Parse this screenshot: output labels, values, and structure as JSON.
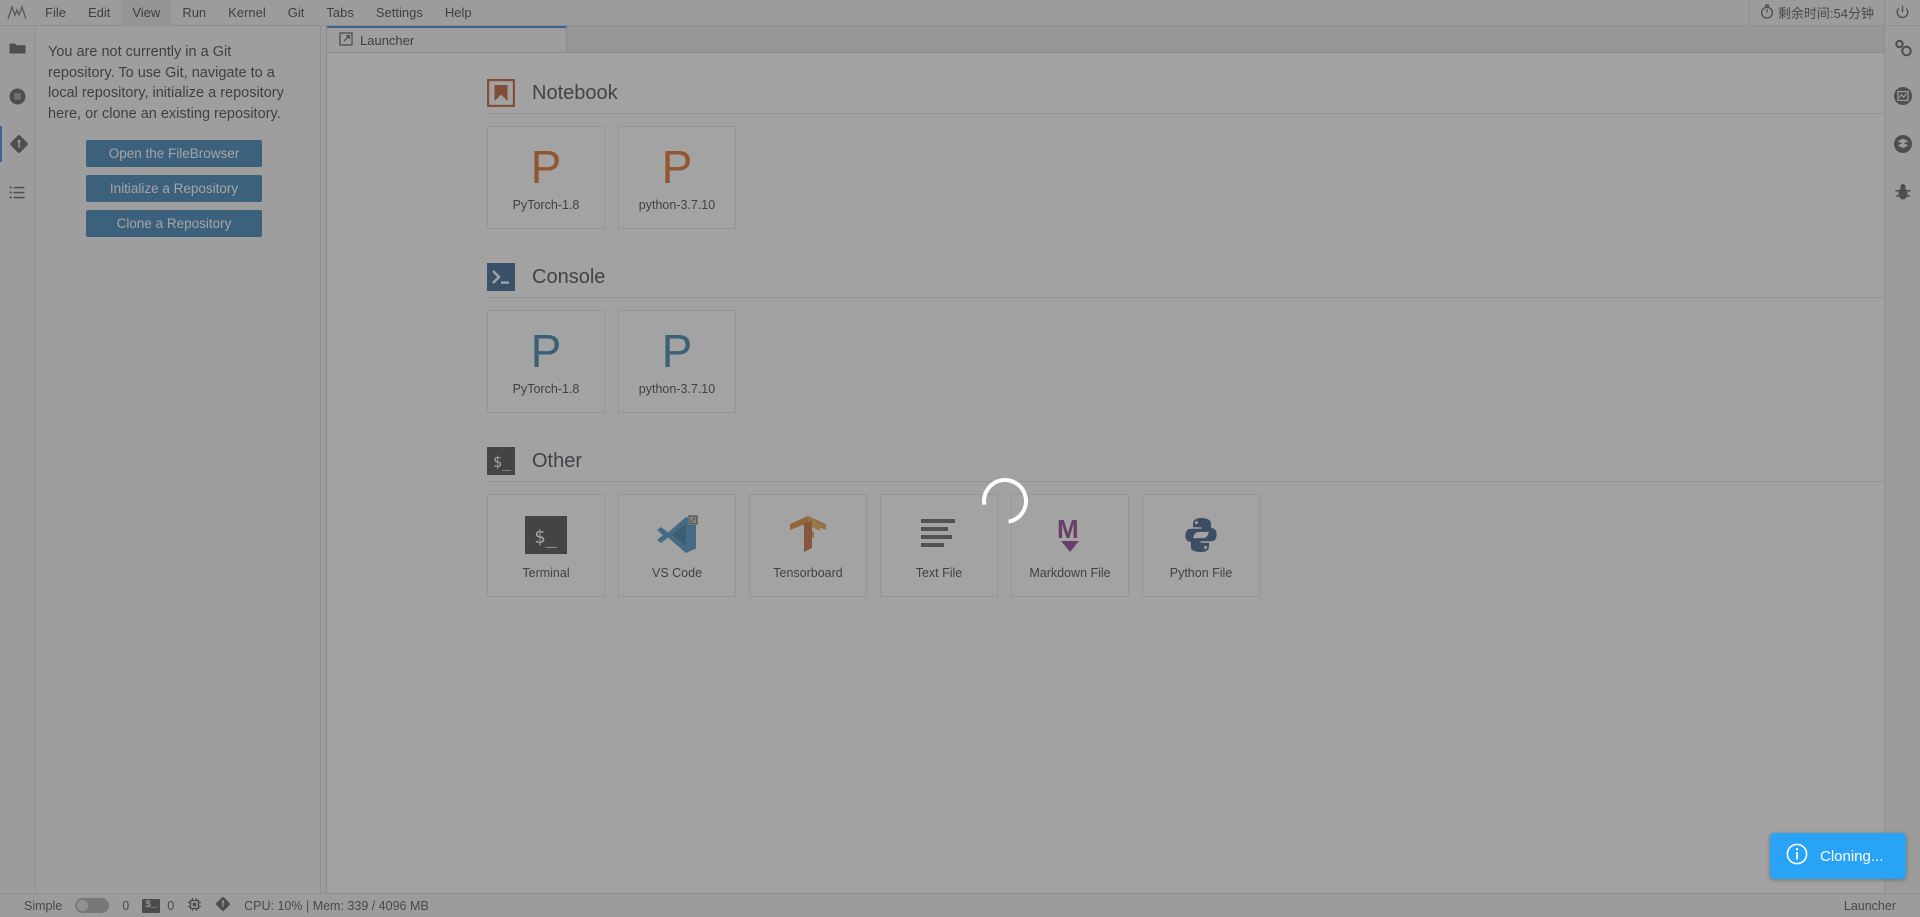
{
  "menubar": {
    "logo_name": "jupyter-logo",
    "items": [
      {
        "label": "File",
        "active": false
      },
      {
        "label": "Edit",
        "active": false
      },
      {
        "label": "View",
        "active": true
      },
      {
        "label": "Run",
        "active": false
      },
      {
        "label": "Kernel",
        "active": false
      },
      {
        "label": "Git",
        "active": false
      },
      {
        "label": "Tabs",
        "active": false
      },
      {
        "label": "Settings",
        "active": false
      },
      {
        "label": "Help",
        "active": false
      }
    ],
    "timer_text": "剩余时间:54分钟",
    "timer_icon": "stopwatch-icon",
    "power_icon": "power-icon"
  },
  "left_activity_bar": {
    "items": [
      {
        "icon": "folder-icon",
        "name": "file-browser"
      },
      {
        "icon": "running-terminals-icon",
        "name": "running-kernels"
      },
      {
        "icon": "git-icon",
        "name": "git-panel",
        "selected": true
      },
      {
        "icon": "table-of-contents-icon",
        "name": "table-of-contents"
      }
    ]
  },
  "right_activity_bar": {
    "items": [
      {
        "icon": "property-inspector-icon",
        "name": "property-inspector"
      },
      {
        "icon": "dashboard-icon",
        "name": "dashboard"
      },
      {
        "icon": "extension-manager-icon",
        "name": "extension-manager"
      },
      {
        "icon": "debugger-bug-icon",
        "name": "debugger"
      }
    ]
  },
  "git_panel": {
    "message": "You are not currently in a Git repository. To use Git, navigate to a local repository, initialize a repository here, or clone an existing repository.",
    "buttons": [
      {
        "label": "Open the FileBrowser"
      },
      {
        "label": "Initialize a Repository"
      },
      {
        "label": "Clone a Repository"
      }
    ],
    "button_color": "#1a6aa8"
  },
  "dock": {
    "tab": {
      "label": "Launcher",
      "icon": "launcher-external-link-icon"
    }
  },
  "launcher": {
    "sections": [
      {
        "title": "Notebook",
        "icon": "notebook-bookmark-icon",
        "icon_color": "#b5400d",
        "cards": [
          {
            "label": "PyTorch-1.8",
            "icon": "python-kernel-icon",
            "icon_color": "#d35400",
            "glyph": "P"
          },
          {
            "label": "python-3.7.10",
            "icon": "python-kernel-icon",
            "icon_color": "#d35400",
            "glyph": "P"
          }
        ]
      },
      {
        "title": "Console",
        "icon": "console-terminal-icon",
        "icon_color": "#15487c",
        "cards": [
          {
            "label": "PyTorch-1.8",
            "icon": "python-kernel-icon",
            "icon_color": "#1a6c9c",
            "glyph": "P"
          },
          {
            "label": "python-3.7.10",
            "icon": "python-kernel-icon",
            "icon_color": "#1a6c9c",
            "glyph": "P"
          }
        ]
      },
      {
        "title": "Other",
        "icon": "terminal-dollar-icon",
        "icon_color": "#2c2c2c",
        "cards": [
          {
            "label": "Terminal",
            "icon": "terminal-dollar-icon"
          },
          {
            "label": "VS Code",
            "icon": "vscode-icon"
          },
          {
            "label": "Tensorboard",
            "icon": "tensorboard-icon"
          },
          {
            "label": "Text File",
            "icon": "text-file-icon"
          },
          {
            "label": "Markdown File",
            "icon": "markdown-file-icon"
          },
          {
            "label": "Python File",
            "icon": "python-file-icon"
          }
        ]
      }
    ],
    "spinner": {
      "name": "loading-spinner",
      "visible": true
    }
  },
  "toast": {
    "icon": "info-icon",
    "message": "Cloning...",
    "color": "#29a3f5"
  },
  "statusbar": {
    "simple_label": "Simple",
    "simple_toggle_on": false,
    "kernel_count": "0",
    "terminal_badge": "$_",
    "terminal_count": "0",
    "cpu_icon": "cpu-chip-icon",
    "git_icon": "git-icon",
    "resources": "CPU: 10% | Mem: 339 / 4096 MB",
    "right_label": "Launcher"
  }
}
